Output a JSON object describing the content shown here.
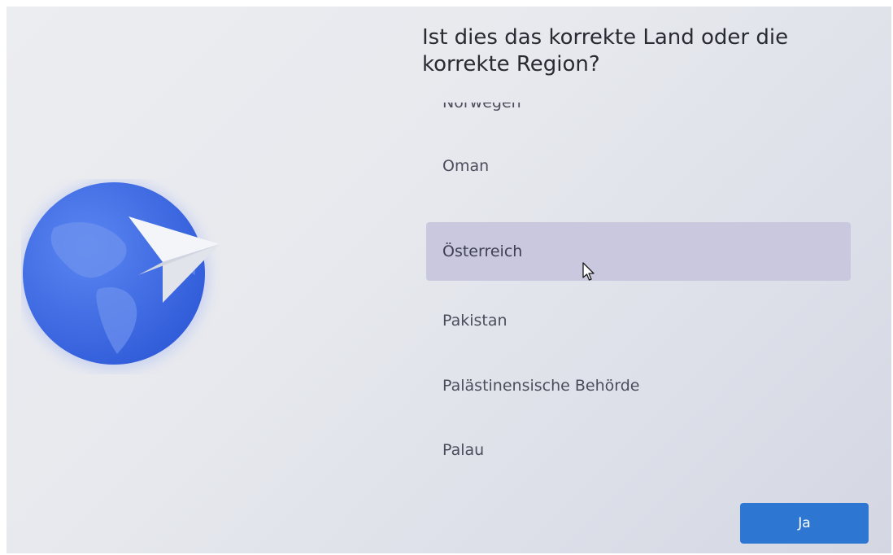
{
  "oobe": {
    "title": "Ist dies das korrekte Land oder die korrekte Region?",
    "countries": [
      {
        "label": "Norwegen"
      },
      {
        "label": "Oman"
      },
      {
        "label": "Österreich",
        "selected": true
      },
      {
        "label": "Pakistan"
      },
      {
        "label": "Palästinensische Behörde"
      },
      {
        "label": "Palau"
      }
    ],
    "primary_button_label": "Ja",
    "illustration": "globe-with-paper-plane-icon",
    "colors": {
      "selected_item": "#c9c8de",
      "button": "#2d77d3",
      "globe": "#3f6ee6"
    }
  }
}
